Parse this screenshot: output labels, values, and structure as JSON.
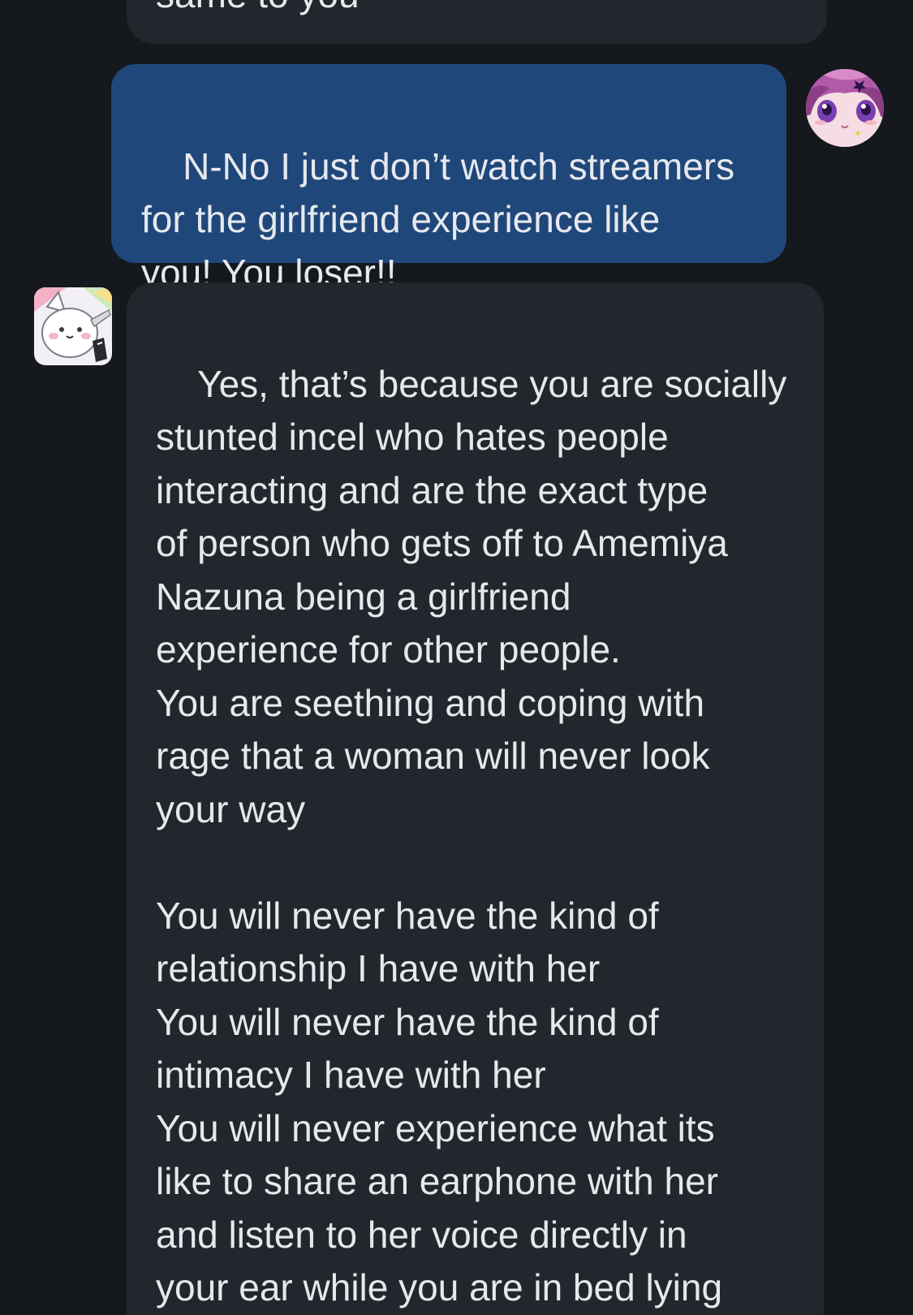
{
  "messages": [
    {
      "sender": "other",
      "text": "same to you"
    },
    {
      "sender": "self",
      "text": "N-No I just don’t watch streamers\nfor the girlfriend experience like\nyou! You loser!!"
    },
    {
      "sender": "other",
      "text": "Yes, that’s because you are socially\nstunted incel who hates people\ninteracting and are the exact type\nof person who gets off to Amemiya\nNazuna being a girlfriend\nexperience for other people.\nYou are seething and coping with\nrage that a woman will never look\nyour way\n\nYou will never have the kind of\nrelationship I have with her\nYou will never have the kind of\nintimacy I have with her\nYou will never experience what its\nlike to share an earphone with her\nand listen to her voice directly in\nyour ear while you are in bed lying\nnext to her"
    }
  ],
  "avatars": {
    "self": "anime-girl-avatar",
    "other": "white-cat-sticker-avatar"
  },
  "colors": {
    "background": "#15181d",
    "received_bubble": "#23262d",
    "sent_bubble": "#1f477a",
    "text": "#e6e8ee"
  }
}
